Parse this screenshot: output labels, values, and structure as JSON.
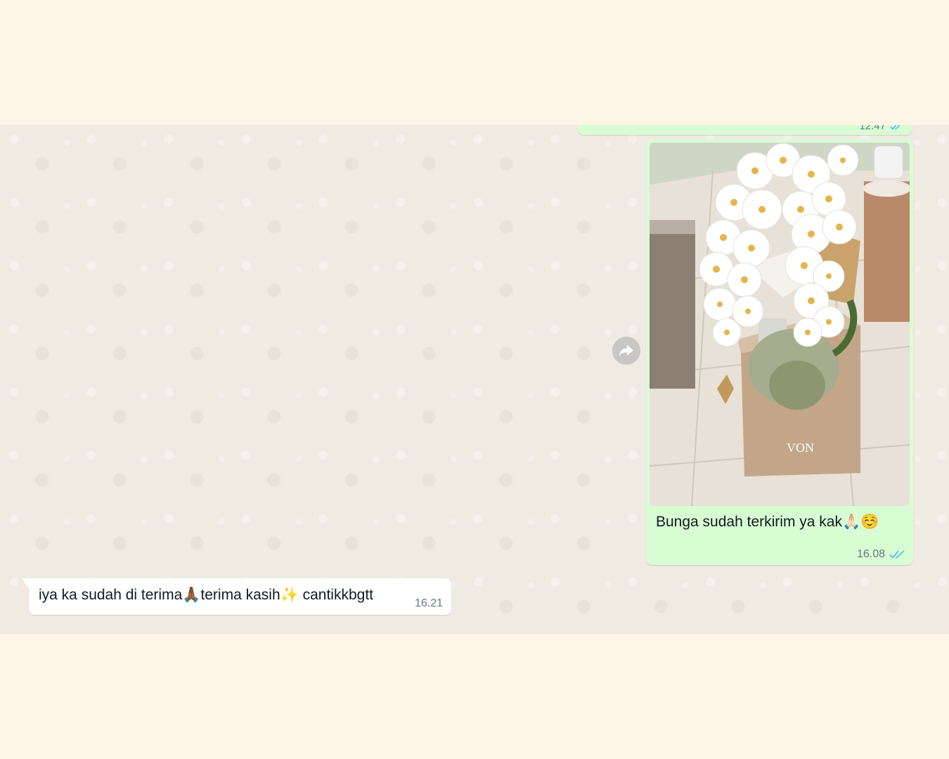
{
  "chat": {
    "previous_message": {
      "time": "12.47",
      "status": "read"
    },
    "outgoing_message": {
      "attachment": "photo",
      "caption": "Bunga sudah terkirim ya kak🙏🏻☺️",
      "time": "16.08",
      "status": "read",
      "photo_box_label": "VON"
    },
    "forward_icon": "forward-icon",
    "incoming_message": {
      "text": "iya ka sudah di terima🙏🏾terima kasih✨ cantikkbgtt",
      "time": "16.21"
    }
  },
  "colors": {
    "outgoing_bubble": "#d9fdd3",
    "incoming_bubble": "#ffffff",
    "chat_background": "#efeae2",
    "read_ticks": "#53bdeb",
    "page_background": "#fdf6e6"
  }
}
